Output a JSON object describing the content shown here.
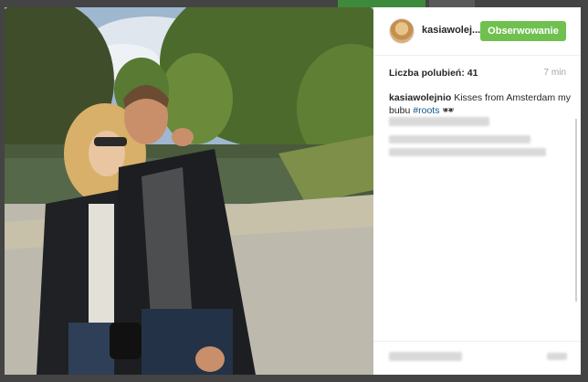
{
  "header": {
    "username": "kasiawolej...",
    "follow_label": "Obserwowanie"
  },
  "stats": {
    "likes_label": "Liczba polubień: 41",
    "time": "7 min"
  },
  "caption": {
    "username": "kasiawolejnio",
    "text": "Kisses from Amsterdam my bubu",
    "hashtag": "#roots",
    "emoji": "🕶"
  },
  "icons": {
    "avatar": "profile-avatar",
    "emoji": "sunglasses-emoji"
  }
}
